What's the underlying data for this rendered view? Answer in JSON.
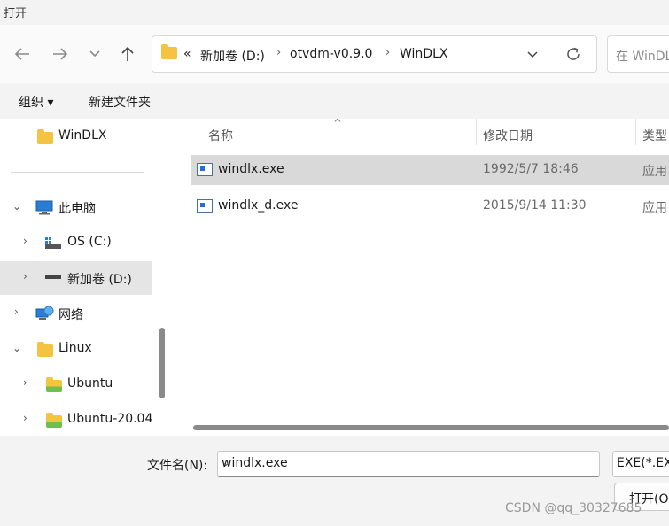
{
  "window": {
    "title": "打开"
  },
  "nav": {
    "back_icon": "arrow-left-icon",
    "forward_icon": "arrow-right-icon",
    "history_icon": "chevron-down-icon",
    "up_icon": "arrow-up-icon"
  },
  "address": {
    "overflow": "«",
    "crumbs": [
      "新加卷 (D:)",
      "otvdm-v0.9.0",
      "WinDLX"
    ],
    "separator": "›",
    "dropdown_icon": "chevron-down-icon",
    "refresh_icon": "refresh-icon"
  },
  "search": {
    "placeholder": "在 WinDLX"
  },
  "toolbar": {
    "organize": "组织 ▾",
    "new_folder": "新建文件夹"
  },
  "sidebar": {
    "items": [
      {
        "label": "WinDLX",
        "icon": "folder-icon"
      },
      {
        "label": "此电脑",
        "icon": "computer-icon",
        "expander": "⌄"
      },
      {
        "label": "OS (C:)",
        "icon": "drive-icon",
        "expander": "›"
      },
      {
        "label": "新加卷 (D:)",
        "icon": "drive-icon",
        "expander": "›"
      },
      {
        "label": "网络",
        "icon": "network-icon",
        "expander": "›"
      },
      {
        "label": "Linux",
        "icon": "folder-icon",
        "expander": "⌄"
      },
      {
        "label": "Ubuntu",
        "icon": "folder-icon",
        "expander": "›"
      },
      {
        "label": "Ubuntu-20.04",
        "icon": "folder-icon",
        "expander": "›"
      }
    ]
  },
  "columns": {
    "name": "名称",
    "modified": "修改日期",
    "type": "类型",
    "sort_indicator": "^"
  },
  "files": [
    {
      "name": "windlx.exe",
      "modified": "1992/5/7 18:46",
      "type": "应用",
      "selected": true
    },
    {
      "name": "windlx_d.exe",
      "modified": "2015/9/14 11:30",
      "type": "应用",
      "selected": false
    }
  ],
  "bottom": {
    "filename_label": "文件名(N):",
    "filename_value": "windlx.exe",
    "filter_value": "EXE(*.EX",
    "open_label": "打开(O",
    "watermark": "CSDN @qq_30327685"
  }
}
